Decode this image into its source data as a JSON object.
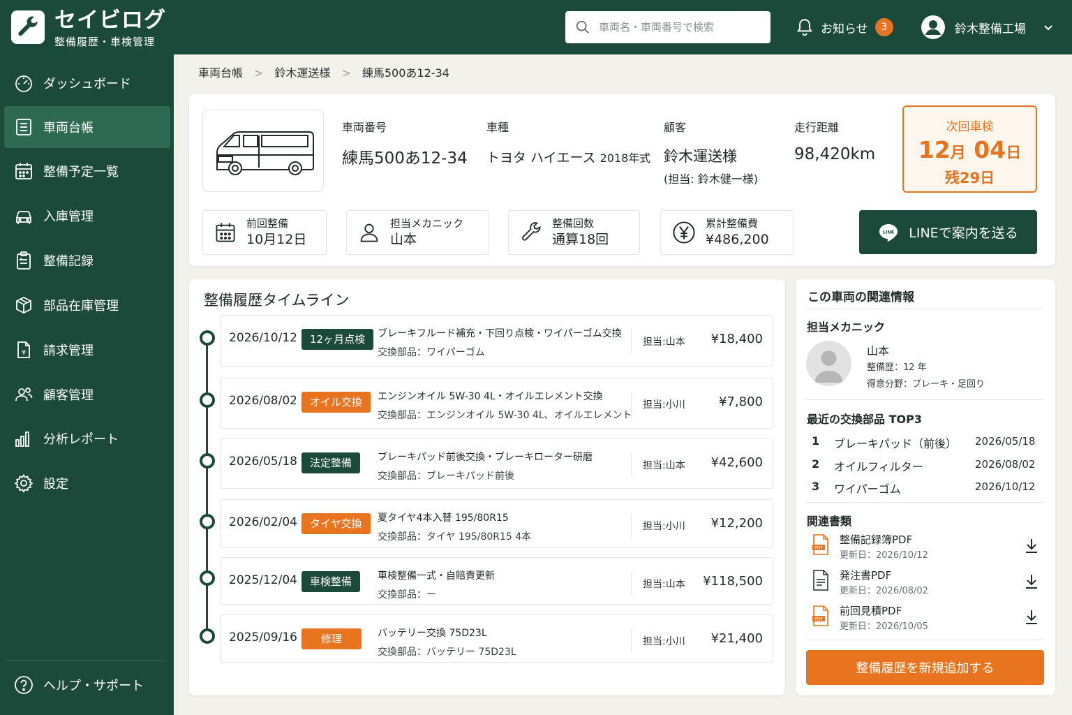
{
  "app": {
    "name": "セイビログ",
    "subtitle": "整備履歴・車検管理",
    "search_placeholder": "車両名・車両番号で検索",
    "notice_label": "お知らせ",
    "notice_count": "3",
    "user_name": "鈴木整備工場"
  },
  "colors": {
    "brand": "#1b4a3a",
    "accent": "#e8741f",
    "active_nav": "#2e6a52"
  },
  "sidebar": {
    "items": [
      {
        "label": "ダッシュボード",
        "icon": "gauge-icon"
      },
      {
        "label": "車両台帳",
        "icon": "document-list-icon",
        "active": true
      },
      {
        "label": "整備予定一覧",
        "icon": "calendar-icon"
      },
      {
        "label": "入庫管理",
        "icon": "car-icon"
      },
      {
        "label": "整備記録",
        "icon": "clipboard-icon"
      },
      {
        "label": "部品在庫管理",
        "icon": "box-icon"
      },
      {
        "label": "請求管理",
        "icon": "invoice-icon"
      },
      {
        "label": "顧客管理",
        "icon": "users-icon"
      },
      {
        "label": "分析レポート",
        "icon": "bar-chart-icon"
      },
      {
        "label": "設定",
        "icon": "gear-icon"
      }
    ],
    "help_label": "ヘルプ・サポート"
  },
  "breadcrumb": [
    "車両台帳",
    "鈴木運送様",
    "練馬500あ12-34"
  ],
  "vehicle": {
    "plate_label": "車両番号",
    "plate": "練馬500あ12-34",
    "model_label": "車種",
    "model": "トヨタ ハイエース",
    "year": "2018年式",
    "customer_label": "顧客",
    "customer": "鈴木運送様",
    "contact": "(担当: 鈴木健一様)",
    "mileage_label": "走行距離",
    "mileage": "98,420km"
  },
  "next_inspection": {
    "label": "次回車検",
    "month": "12",
    "month_unit": "月",
    "day": "04",
    "day_unit": "日",
    "remaining": "残29日"
  },
  "stats": [
    {
      "label": "前回整備",
      "value": "10月12日",
      "icon": "calendar-icon"
    },
    {
      "label": "担当メカニック",
      "value": "山本",
      "icon": "person-icon"
    },
    {
      "label": "整備回数",
      "value": "通算18回",
      "icon": "wrench-icon"
    },
    {
      "label": "累計整備費",
      "value": "¥486,200",
      "icon": "yen-icon"
    }
  ],
  "line_button": "LINEで案内を送る",
  "line_icon_text": "LINE",
  "timeline": {
    "title": "整備履歴タイムライン",
    "entries": [
      {
        "date": "2026/10/12",
        "tag": "12ヶ月点検",
        "tag_color": "green",
        "desc": "ブレーキフルード補充・下回り点検・ワイパーゴム交換",
        "parts": "交換部品：ワイパーゴム",
        "staff": "担当:山本",
        "amount": "¥18,400"
      },
      {
        "date": "2026/08/02",
        "tag": "オイル交換",
        "tag_color": "orange",
        "desc": "エンジンオイル 5W-30 4L・オイルエレメント交換",
        "parts": "交換部品：エンジンオイル 5W-30 4L、オイルエレメント",
        "staff": "担当:小川",
        "amount": "¥7,800"
      },
      {
        "date": "2026/05/18",
        "tag": "法定整備",
        "tag_color": "green",
        "desc": "ブレーキパッド前後交換・ブレーキローター研磨",
        "parts": "交換部品：ブレーキパッド前後",
        "staff": "担当:山本",
        "amount": "¥42,600"
      },
      {
        "date": "2026/02/04",
        "tag": "タイヤ交換",
        "tag_color": "orange",
        "desc": "夏タイヤ4本入替 195/80R15",
        "parts": "交換部品：タイヤ 195/80R15 4本",
        "staff": "担当:小川",
        "amount": "¥12,200"
      },
      {
        "date": "2025/12/04",
        "tag": "車検整備",
        "tag_color": "green",
        "desc": "車検整備一式・自賠責更新",
        "parts": "交換部品：ー",
        "staff": "担当:山本",
        "amount": "¥118,500"
      },
      {
        "date": "2025/09/16",
        "tag": "修理",
        "tag_color": "orange",
        "desc": "バッテリー交換 75D23L",
        "parts": "交換部品：バッテリー 75D23L",
        "staff": "担当:小川",
        "amount": "¥21,400"
      }
    ]
  },
  "related": {
    "title": "この車両の関連情報",
    "mechanic_section": "担当メカニック",
    "mechanic_name": "山本",
    "mechanic_experience": "整備歴：12 年",
    "mechanic_specialty": "得意分野：ブレーキ・足回り",
    "top_parts_section": "最近の交換部品 TOP3",
    "top_parts": [
      {
        "rank": "1",
        "name": "ブレーキパッド（前後）",
        "date": "2026/05/18"
      },
      {
        "rank": "2",
        "name": "オイルフィルター",
        "date": "2026/08/02"
      },
      {
        "rank": "3",
        "name": "ワイパーゴム",
        "date": "2026/10/12"
      }
    ],
    "docs_section": "関連書類",
    "docs": [
      {
        "name": "整備記録簿PDF",
        "updated": "更新日：2026/10/12",
        "icon": "pdf-icon"
      },
      {
        "name": "発注書PDF",
        "updated": "更新日：2026/08/02",
        "icon": "document-icon"
      },
      {
        "name": "前回見積PDF",
        "updated": "更新日：2026/10/05",
        "icon": "pdf-icon"
      }
    ],
    "pdf_icon_text": "PDF",
    "add_button": "整備履歴を新規追加する"
  }
}
